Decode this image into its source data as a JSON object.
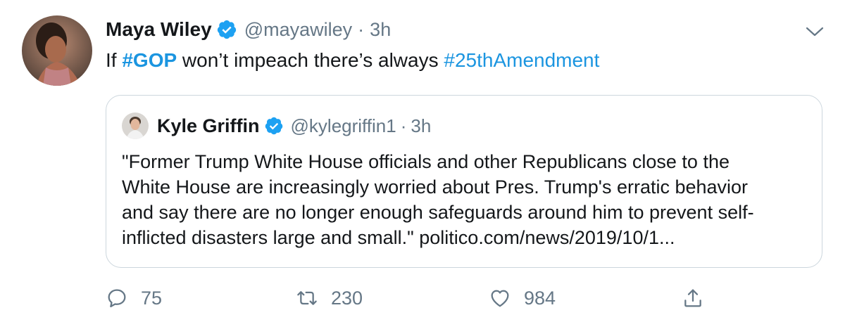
{
  "author": {
    "name": "Maya Wiley",
    "handle": "@mayawiley",
    "separator": "·",
    "time": "3h",
    "verified_icon": "verified-badge-icon"
  },
  "tweet": {
    "text_1": "If ",
    "hashtag_1": "#GOP",
    "text_2": " won’t impeach there’s always ",
    "hashtag_2": "#25thAmendment"
  },
  "quoted": {
    "name": "Kyle Griffin",
    "handle": "@kylegriffin1",
    "separator": "·",
    "time": "3h",
    "lines": [
      "\"Former Trump White House officials and other Republicans close to the",
      "White House are increasingly worried about Pres. Trump's erratic behavior",
      "and say there are no longer enough safeguards around him to prevent self-",
      "inflicted disasters large and small.\" politico.com/news/2019/10/1..."
    ]
  },
  "actions": {
    "reply_count": "75",
    "retweet_count": "230",
    "like_count": "984"
  },
  "colors": {
    "link": "#1b95e0",
    "verified": "#1da1f2",
    "secondary_text": "#657786",
    "border": "#ccd6dd"
  }
}
